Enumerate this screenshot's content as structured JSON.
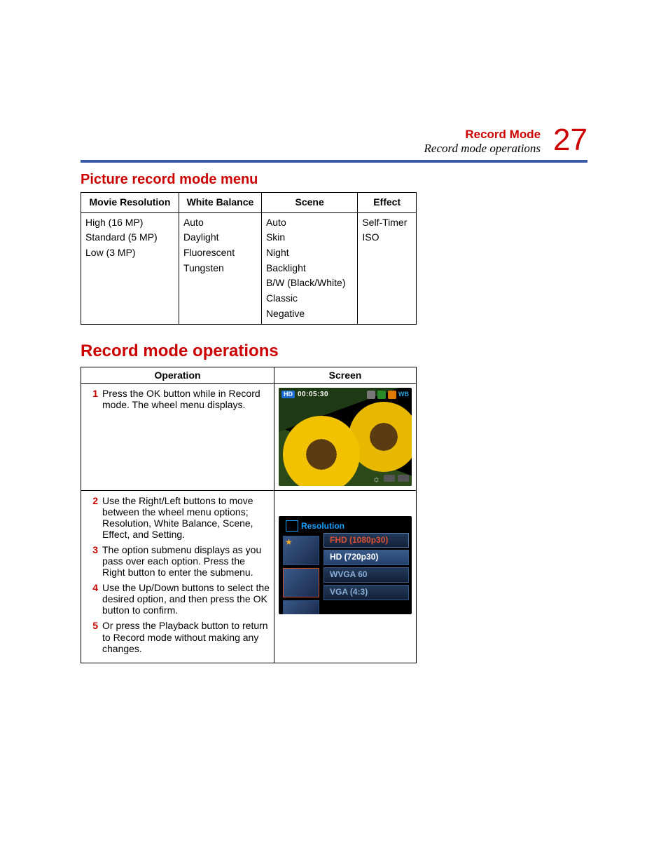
{
  "header": {
    "chapter": "Record Mode",
    "section": "Record mode operations",
    "page_number": "27"
  },
  "picture_menu": {
    "heading": "Picture record mode menu",
    "columns": [
      "Movie Resolution",
      "White Balance",
      "Scene",
      "Effect"
    ],
    "col1": [
      "High (16 MP)",
      "Standard (5 MP)",
      "Low (3 MP)"
    ],
    "col2": [
      "Auto",
      "Daylight",
      "Fluorescent",
      "Tungsten"
    ],
    "col3": [
      "Auto",
      "Skin",
      "Night",
      "Backlight",
      "B/W (Black/White)",
      "Classic",
      "Negative"
    ],
    "col4": [
      "Self-Timer",
      "ISO"
    ]
  },
  "operations": {
    "heading": "Record mode operations",
    "columns": [
      "Operation",
      "Screen"
    ],
    "steps_group1": [
      {
        "n": "1",
        "text": "Press the OK button while in Record mode. The wheel menu displays."
      }
    ],
    "steps_group2": [
      {
        "n": "2",
        "text": "Use the Right/Left buttons to move between the wheel menu options; Resolution, White Balance, Scene, Effect, and Setting."
      },
      {
        "n": "3",
        "text": "The option submenu displays as you pass over each option. Press the Right button to enter the submenu."
      },
      {
        "n": "4",
        "text": "Use the Up/Down buttons to select the desired option, and then press the OK button to confirm."
      },
      {
        "n": "5",
        "text": "Or press the Playback button to return to Record mode without making any changes."
      }
    ]
  },
  "screen1": {
    "hd_label": "HD",
    "timecode": "00:05:30",
    "wb_label": "WB"
  },
  "screen2": {
    "title": "Resolution",
    "options": [
      "FHD (1080p30)",
      "HD (720p30)",
      "WVGA 60",
      "VGA (4:3)"
    ]
  }
}
